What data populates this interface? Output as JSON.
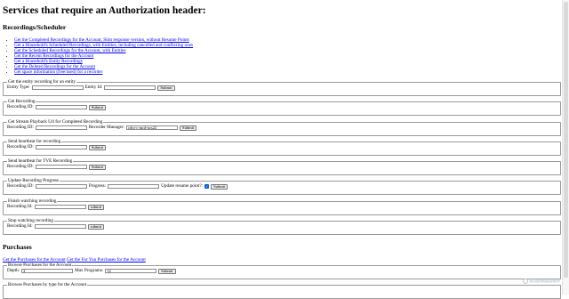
{
  "page": {
    "title": "Services that require an Authorization header:"
  },
  "recordings": {
    "heading": "Recordings/Scheduler",
    "links": [
      "Get the Completed Recordings for the Account, Slim response version, without Resume Points",
      "Get a Household's Scheduled Recordings, with Entities, including cancelled and conflicting ones",
      "Get the Scheduled Recordings for the Account, with Entities",
      "Get the Recent Recordings for the Account",
      "Get a Household's Entity Recordings",
      "Get the Deleted Recordings for the Account",
      "Get space information (free/used) for a recorder"
    ]
  },
  "forms": {
    "entity": {
      "legend": "Get the entity recording for an entity",
      "entity_type_label": "Entity Type:",
      "entity_type_value": "",
      "entity_id_label": "Entity Id:",
      "entity_id_value": "",
      "submit": "Submit"
    },
    "get_recording": {
      "legend": "Get Recording",
      "id_label": "Recording ID:",
      "id_value": "",
      "submit": "Submit"
    },
    "stream": {
      "legend": "Get Stream Playback Url for Completed Recording",
      "id_label": "Recording ID:",
      "id_value": "",
      "manager_label": "Recorder Manager:",
      "manager_value": "cdvr-c-mrd-ncs22",
      "submit": "Submit"
    },
    "heartbeat": {
      "legend": "Send heartbeat for recording",
      "id_label": "Recording ID:",
      "id_value": "",
      "submit": "Submit"
    },
    "heartbeat_tve": {
      "legend": "Send heartbeat for TVE Recording",
      "id_label": "Recording ID:",
      "id_value": "",
      "submit": "Submit"
    },
    "progress": {
      "legend": "Update Recording Progress",
      "id_label": "Recording ID:",
      "id_value": "",
      "progress_label": "Progress:",
      "progress_value": "",
      "resume_label": "Update resume point?:",
      "resume_checked": "✓",
      "submit": "Submit"
    },
    "finish": {
      "legend": "Finish watching recording",
      "id_label": "Recording Id:",
      "id_value": "",
      "submit": "submit"
    },
    "stop": {
      "legend": "Stop watching recording",
      "id_label": "Recording Id:",
      "id_value": "",
      "submit": "submit"
    }
  },
  "purchases": {
    "heading": "Purchases",
    "link1": "Get the Purchases for the Account",
    "link2": "Get the For You Purchases for the Account",
    "browse": {
      "legend": "Browse Purchases for the Account",
      "depth_label": "Depth:",
      "depth_value": "2",
      "max_label": "Max Programs:",
      "max_value": "12",
      "submit": "Submit"
    },
    "browse_type": {
      "legend": "Browse Purchases by type for the Account"
    }
  },
  "watermark": {
    "text": "ScanMalware"
  }
}
